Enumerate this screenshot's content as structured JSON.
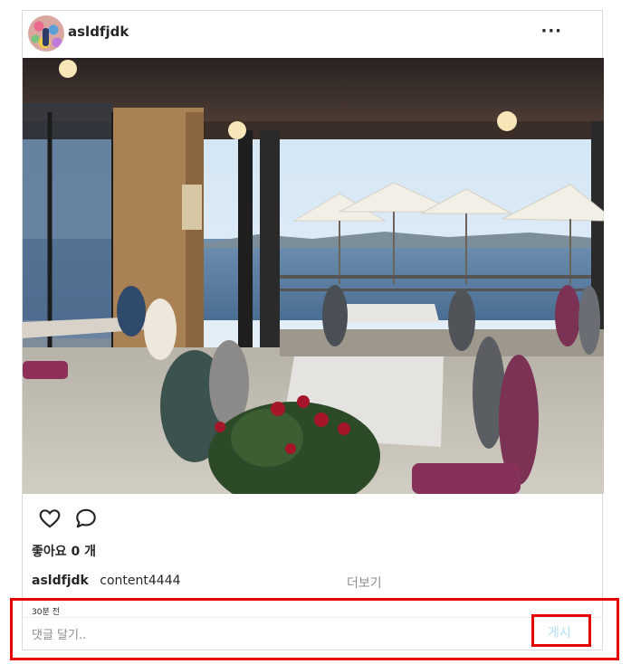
{
  "post": {
    "username": "asldfjdk",
    "more_label": "···",
    "likes_label": "좋아요 0 개",
    "caption_user": "asldfjdk",
    "caption_text": "content4444",
    "more_link": "더보기",
    "time_label": "30분 전"
  },
  "comment": {
    "placeholder": "댓글 달기..",
    "value": "",
    "post_label": "게시"
  },
  "icons": {
    "like": "heart-icon",
    "comment": "speech-bubble-icon",
    "more": "more-dots-icon"
  },
  "colors": {
    "post_button_disabled": "#b2dffc",
    "highlight": "#e60000"
  }
}
